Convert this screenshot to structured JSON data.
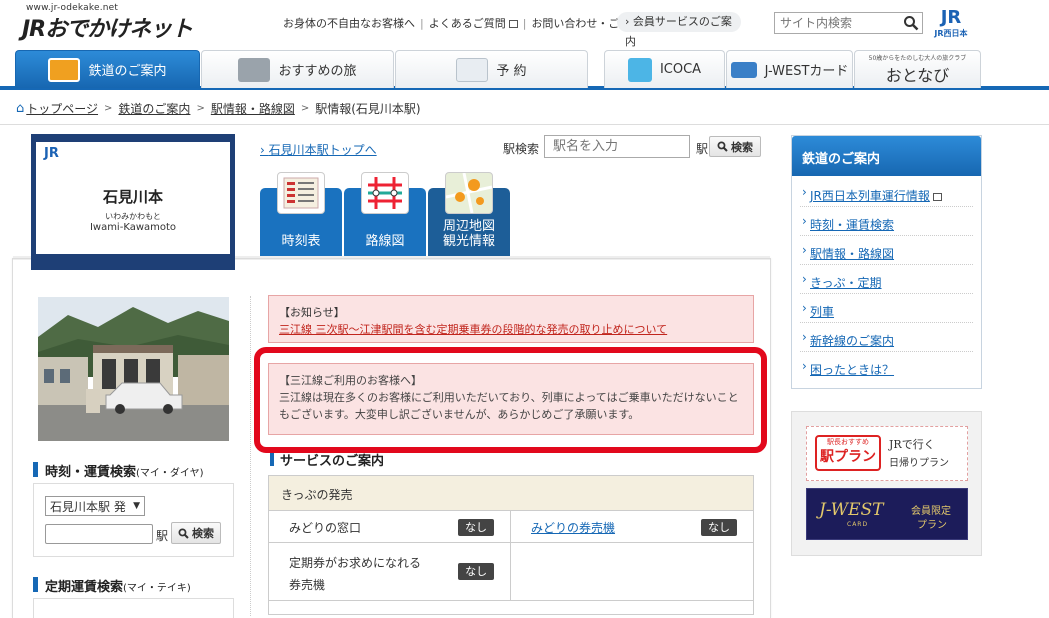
{
  "header": {
    "logo_url": "www.jr-odekake.net",
    "logo": "JRおでかけネット",
    "util_links": [
      "お身体の不自由なお客様へ",
      "よくあるご質問",
      "お問い合わせ・ご意見"
    ],
    "member": "会員サービスのご案内",
    "search_placeholder": "サイト内検索",
    "corp_logo": "JR",
    "corp_name": "JR西日本"
  },
  "nav": {
    "tabs": [
      "鉄道のご案内",
      "おすすめの旅",
      "予 約",
      "ICOCA",
      "J-WESTカード",
      "おとなび"
    ],
    "otonavi_sub": "50歳からをたのしむ大人の旅クラブ"
  },
  "breadcrumb": [
    "トップページ",
    "鉄道のご案内",
    "駅情報・路線図",
    "駅情報(石見川本駅)"
  ],
  "station": {
    "jr": "JR",
    "name": "石見川本",
    "kana": "いわみかわもと",
    "roman": "Iwami-Kawamoto",
    "top_link": "石見川本駅トップへ",
    "search_label": "駅検索",
    "search_placeholder": "駅名を入力",
    "search_suffix": "駅",
    "search_button": "検索",
    "tabs": [
      "時刻表",
      "路線図",
      "周辺地図\n観光情報"
    ]
  },
  "left": {
    "timetable_head": "時刻・運賃検索",
    "timetable_sub": "(マイ・ダイヤ)",
    "direction_select": "石見川本駅 発",
    "search_suffix": "駅",
    "search_button": "検索",
    "pass_head": "定期運賃検索",
    "pass_sub": "(マイ・テイキ)"
  },
  "notices": {
    "n1_title": "【お知らせ】",
    "n1_link": "三江線 三次駅〜江津駅間を含む定期乗車券の段階的な発売の取り止めについて",
    "n2_title": "【三江線ご利用のお客様へ】",
    "n2_body": "三江線は現在多くのお客様にご利用いただいており、列車によってはご乗車いただけないこともございます。大変申し訳ございませんが、あらかじめご了承願います。"
  },
  "service": {
    "heading": "サービスのご案内",
    "caption": "きっぷの発売",
    "rows": [
      {
        "left": "みどりの窓口",
        "left_badge": "なし",
        "right": "みどりの券売機",
        "right_badge": "なし"
      },
      {
        "left": "定期券がお求めになれる券売機",
        "left_badge": "なし",
        "right": "",
        "right_badge": ""
      }
    ]
  },
  "right": {
    "heading": "鉄道のご案内",
    "links": [
      "JR西日本列車運行情報",
      "時刻・運賃検索",
      "駅情報・路線図",
      "きっぷ・定期",
      "列車",
      "新幹線のご案内",
      "困ったときは？"
    ],
    "banner1_a": "駅長おすすめ",
    "banner1_b": "駅プラン",
    "banner1_c": "JRで行く",
    "banner1_d": "日帰りプラン",
    "banner2_a": "J-WEST",
    "banner2_b": "CARD",
    "banner2_c": "会員限定",
    "banner2_d": "プラン"
  },
  "colors": {
    "brand": "#1668b5",
    "alert": "#e2081c",
    "notice_bg": "#fbe3e3"
  }
}
